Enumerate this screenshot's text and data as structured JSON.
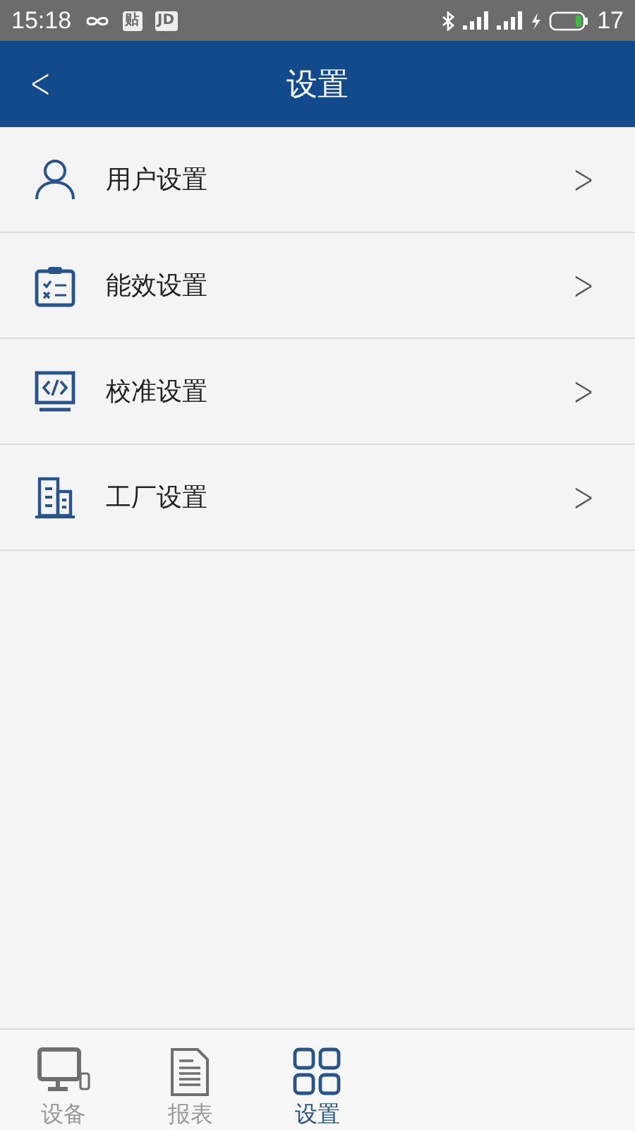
{
  "status_bar": {
    "time": "15:18",
    "badges": [
      "贴",
      "JD"
    ],
    "battery": "17"
  },
  "header": {
    "back": "<",
    "title": "设置"
  },
  "menu": [
    {
      "kind": "user",
      "label": "用户设置",
      "chevron": ">"
    },
    {
      "kind": "clipboard",
      "label": "能效设置",
      "chevron": ">"
    },
    {
      "kind": "code",
      "label": "校准设置",
      "chevron": ">"
    },
    {
      "kind": "building",
      "label": "工厂设置",
      "chevron": ">"
    }
  ],
  "tabs": [
    {
      "kind": "monitor",
      "label": "设备",
      "selected": false
    },
    {
      "kind": "document",
      "label": "报表",
      "selected": false
    },
    {
      "kind": "grid",
      "label": "设置",
      "selected": true
    }
  ]
}
